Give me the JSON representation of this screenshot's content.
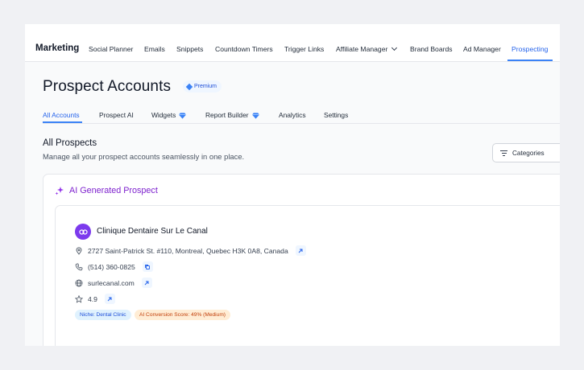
{
  "topnav": {
    "brand": "Marketing",
    "items": [
      {
        "label": "Social Planner"
      },
      {
        "label": "Emails"
      },
      {
        "label": "Snippets"
      },
      {
        "label": "Countdown Timers"
      },
      {
        "label": "Trigger Links"
      },
      {
        "label": "Affiliate Manager"
      },
      {
        "label": "Brand Boards"
      },
      {
        "label": "Ad Manager"
      },
      {
        "label": "Prospecting"
      }
    ],
    "active": "Prospecting"
  },
  "page": {
    "title": "Prospect Accounts",
    "badge": "Premium"
  },
  "subtabs": {
    "items": [
      {
        "label": "All Accounts"
      },
      {
        "label": "Prospect AI"
      },
      {
        "label": "Widgets"
      },
      {
        "label": "Report Builder"
      },
      {
        "label": "Analytics"
      },
      {
        "label": "Settings"
      }
    ],
    "active": "All Accounts"
  },
  "section": {
    "title": "All Prospects",
    "description": "Manage all your prospect accounts seamlessly in one place.",
    "categories_label": "Categories"
  },
  "ai_card": {
    "title": "AI Generated Prospect",
    "prospect": {
      "name": "Clinique Dentaire Sur Le Canal",
      "address": "2727 Saint-Patrick St. #110, Montreal, Quebec H3K 0A8, Canada",
      "phone": "(514) 360-0825",
      "website": "surlecanal.com",
      "rating": "4.9",
      "tags": {
        "niche": "Niche: Dental Clinic",
        "score": "AI Conversion Score: 49% (Medium)"
      }
    }
  },
  "colors": {
    "accent": "#2563eb",
    "ai_purple": "#7e22ce",
    "avatar": "#7c3aed"
  },
  "icons": [
    "diamond-icon",
    "filter-icon",
    "sparkle-icon",
    "location-pin-icon",
    "phone-icon",
    "globe-icon",
    "star-icon",
    "external-link-icon",
    "copy-icon",
    "chevron-down-icon"
  ]
}
